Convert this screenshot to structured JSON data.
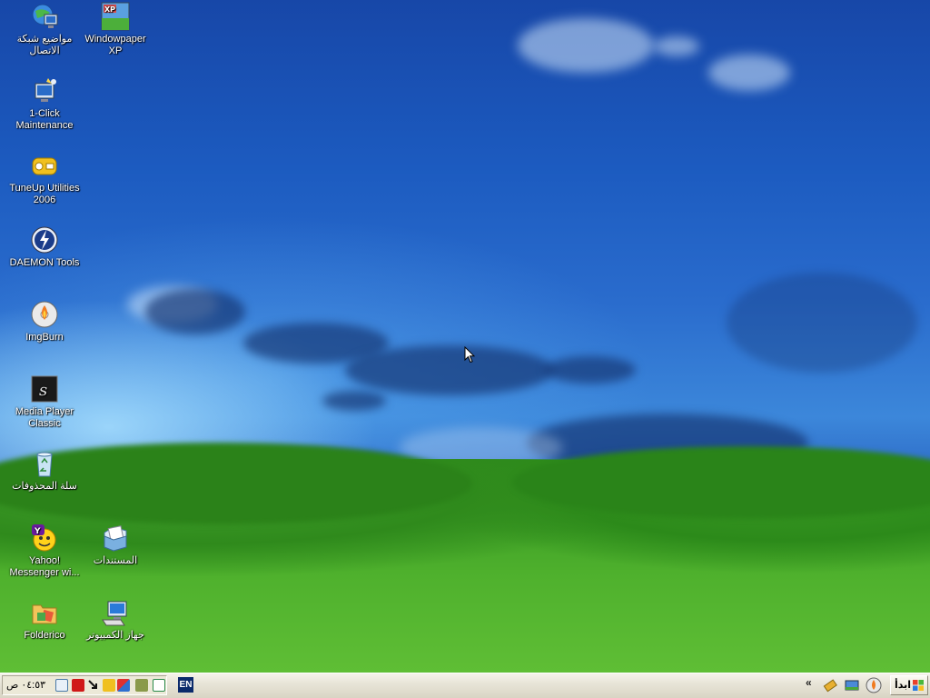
{
  "desktop": {
    "icons": [
      {
        "label": "مواضيع شبكة الاتصال",
        "icon": "network-places-icon"
      },
      {
        "label": "Windowpaper XP",
        "icon": "windowpaper-xp-icon"
      },
      {
        "label": "1-Click Maintenance",
        "icon": "maintenance-icon"
      },
      {
        "label": "TuneUp Utilities 2006",
        "icon": "tuneup-icon"
      },
      {
        "label": "DAEMON Tools",
        "icon": "daemon-tools-icon"
      },
      {
        "label": "ImgBurn",
        "icon": "imgburn-icon"
      },
      {
        "label": "Media Player Classic",
        "icon": "media-player-classic-icon"
      },
      {
        "label": "سلة المحذوفات",
        "icon": "recycle-bin-icon"
      },
      {
        "label": "Yahoo! Messenger wi...",
        "icon": "yahoo-messenger-icon"
      },
      {
        "label": "المستندات",
        "icon": "my-documents-icon"
      },
      {
        "label": "Folderico",
        "icon": "folderico-icon"
      },
      {
        "label": "جهاز الكمبيوتر",
        "icon": "my-computer-icon"
      }
    ]
  },
  "taskbar": {
    "clock": "٠٤:٥٣ ص",
    "language": "EN",
    "start_label": "ابدأ",
    "chevron": "«",
    "colors": {
      "taskbar": "#ece9d8",
      "lang_bg": "#0b2a6b"
    }
  }
}
